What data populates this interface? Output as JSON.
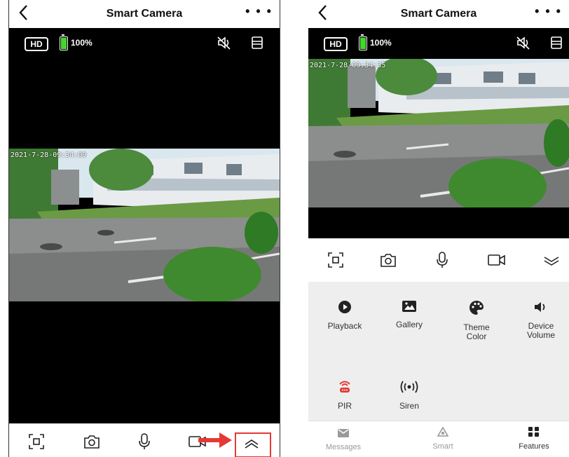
{
  "left": {
    "nav": {
      "title": "Smart Camera",
      "more": "• • •"
    },
    "video": {
      "hd": "HD",
      "battery": "100%",
      "timestamp": "2021-7-28-09:34:09"
    }
  },
  "right": {
    "nav": {
      "title": "Smart Camera",
      "more": "• • •"
    },
    "video": {
      "hd": "HD",
      "battery": "100%",
      "timestamp": "2021-7-28-09:34:35"
    },
    "features": [
      {
        "label": "Playback",
        "icon": "play-circle-icon"
      },
      {
        "label": "Gallery",
        "icon": "gallery-icon"
      },
      {
        "label": "Theme Color",
        "icon": "palette-icon"
      },
      {
        "label": "Device Volume",
        "icon": "speaker-icon"
      },
      {
        "label": "PIR",
        "icon": "pir-sensor-icon"
      },
      {
        "label": "Siren",
        "icon": "siren-icon"
      }
    ],
    "tabs": [
      {
        "label": "Messages",
        "icon": "mail-icon"
      },
      {
        "label": "Smart",
        "icon": "smart-icon"
      },
      {
        "label": "Features",
        "icon": "grid-icon"
      }
    ]
  },
  "colors": {
    "accent_red": "#e53935",
    "battery_green": "#44d62c"
  }
}
